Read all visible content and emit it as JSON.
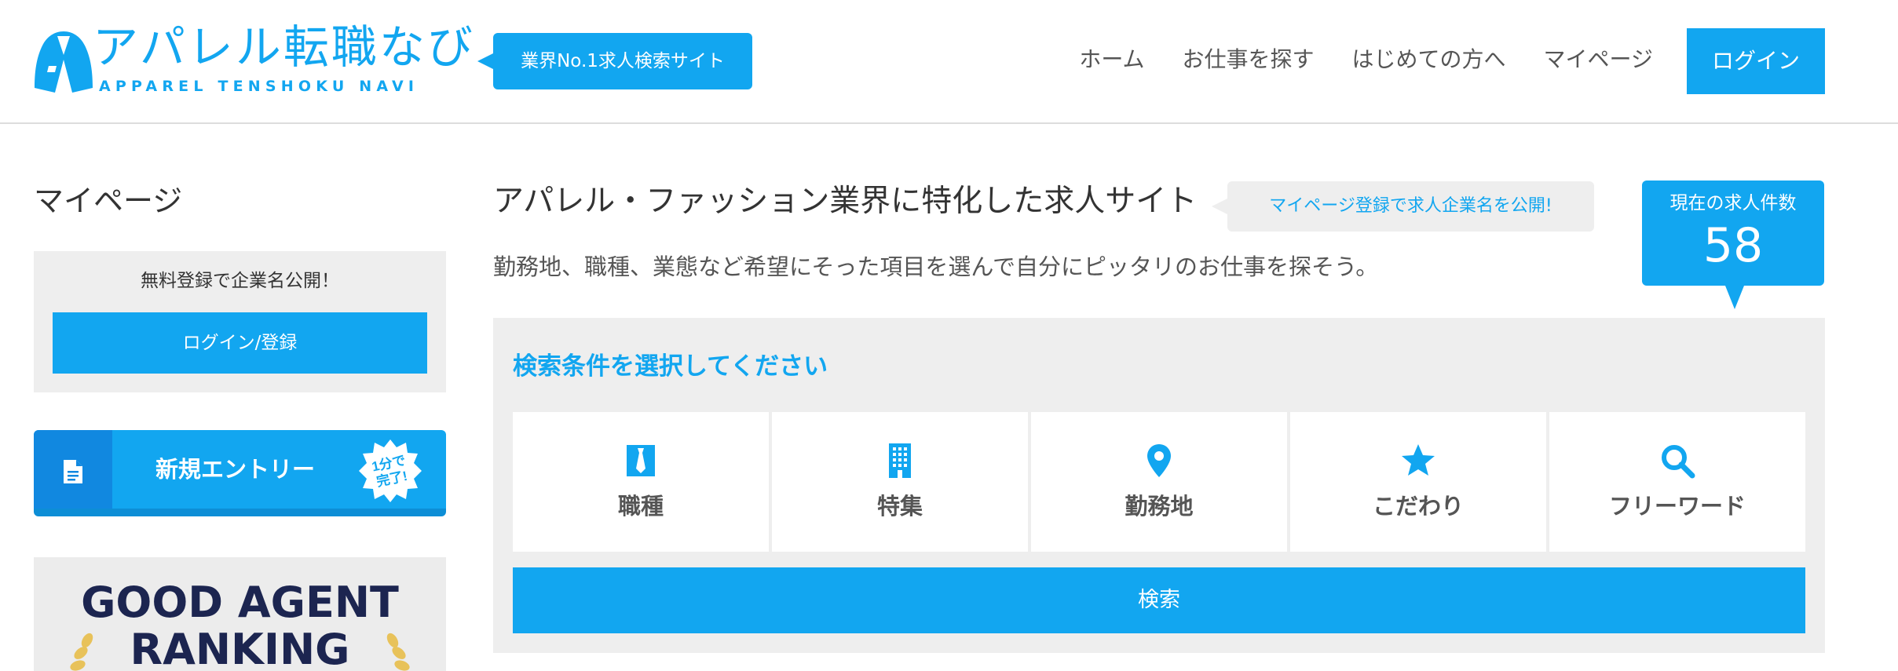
{
  "brand": {
    "title": "アパレル転職なび",
    "subtitle": "APPAREL TENSHOKU NAVI",
    "catch": "業界No.1求人検索サイト",
    "color": "#12a6f0"
  },
  "nav": {
    "items": [
      "ホーム",
      "お仕事を探す",
      "はじめての方へ",
      "マイページ"
    ],
    "login": "ログイン"
  },
  "sidebar": {
    "title": "マイページ",
    "box_text": "無料登録で企業名公開！",
    "login_register": "ログイン/登録",
    "entry_label": "新規エントリー",
    "entry_badge": "1分で完了!",
    "ranking_line1": "GOOD AGENT",
    "ranking_line2": "RANKING"
  },
  "main": {
    "title": "アパレル・ファッション業界に特化した求人サイト",
    "register_bubble": "マイページ登録で求人企業名を公開!",
    "count_label": "現在の求人件数",
    "count_value": "58",
    "description": "勤務地、職種、業態など希望にそった項目を選んで自分にピッタリのお仕事を探そう。"
  },
  "search": {
    "heading": "検索条件を選択してください",
    "tiles": [
      {
        "label": "職種",
        "icon": "necktie-icon"
      },
      {
        "label": "特集",
        "icon": "building-icon"
      },
      {
        "label": "勤務地",
        "icon": "map-pin-icon"
      },
      {
        "label": "こだわり",
        "icon": "star-icon"
      },
      {
        "label": "フリーワード",
        "icon": "search-icon"
      }
    ],
    "button": "検索"
  }
}
